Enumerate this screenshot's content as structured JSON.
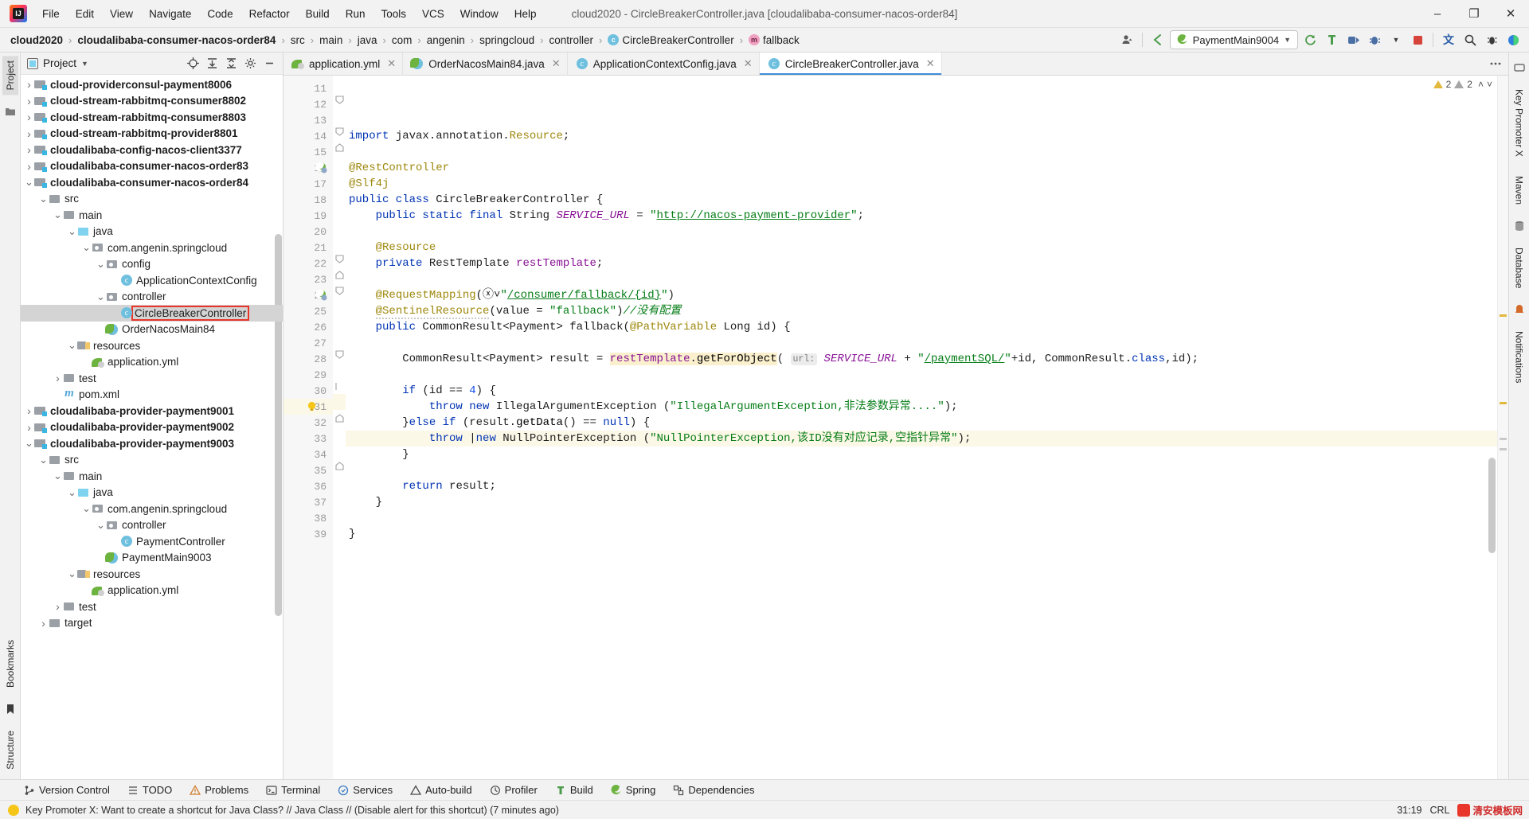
{
  "window": {
    "title": "cloud2020 - CircleBreakerController.java [cloudalibaba-consumer-nacos-order84]",
    "minimize": "–",
    "maximize": "❐",
    "close": "✕"
  },
  "menubar": [
    {
      "label": "File"
    },
    {
      "label": "Edit"
    },
    {
      "label": "View"
    },
    {
      "label": "Navigate"
    },
    {
      "label": "Code"
    },
    {
      "label": "Refactor"
    },
    {
      "label": "Build"
    },
    {
      "label": "Run"
    },
    {
      "label": "Tools"
    },
    {
      "label": "VCS"
    },
    {
      "label": "Window"
    },
    {
      "label": "Help"
    }
  ],
  "breadcrumb": [
    {
      "label": "cloud2020",
      "bold": true
    },
    {
      "label": "cloudalibaba-consumer-nacos-order84",
      "bold": true
    },
    {
      "label": "src",
      "bold": false
    },
    {
      "label": "main",
      "bold": false
    },
    {
      "label": "java",
      "bold": false
    },
    {
      "label": "com",
      "bold": false
    },
    {
      "label": "angenin",
      "bold": false
    },
    {
      "label": "springcloud",
      "bold": false
    },
    {
      "label": "controller",
      "bold": false
    },
    {
      "label": "CircleBreakerController",
      "bold": false,
      "badge": "c"
    },
    {
      "label": "fallback",
      "bold": false,
      "badge": "m"
    }
  ],
  "toolbar": {
    "run_config": "PaymentMain9004",
    "icons": [
      "user-icon",
      "back-arrow-icon",
      "update-project-icon",
      "build-icon",
      "run-icon",
      "debug-icon",
      "stop-icon",
      "translate-icon",
      "search-icon",
      "bug-icon",
      "ide-icon"
    ]
  },
  "project_panel": {
    "title": "Project",
    "tools": [
      "locate-icon",
      "expand-all-icon",
      "collapse-all-icon",
      "settings-icon",
      "hide-icon"
    ],
    "tree": [
      {
        "label": "cloud-providerconsul-payment8006",
        "indent": 1,
        "arrow": "collapsed",
        "icon": "module",
        "bold": true
      },
      {
        "label": "cloud-stream-rabbitmq-consumer8802",
        "indent": 1,
        "arrow": "collapsed",
        "icon": "module",
        "bold": true
      },
      {
        "label": "cloud-stream-rabbitmq-consumer8803",
        "indent": 1,
        "arrow": "collapsed",
        "icon": "module",
        "bold": true
      },
      {
        "label": "cloud-stream-rabbitmq-provider8801",
        "indent": 1,
        "arrow": "collapsed",
        "icon": "module",
        "bold": true
      },
      {
        "label": "cloudalibaba-config-nacos-client3377",
        "indent": 1,
        "arrow": "collapsed",
        "icon": "module",
        "bold": true
      },
      {
        "label": "cloudalibaba-consumer-nacos-order83",
        "indent": 1,
        "arrow": "collapsed",
        "icon": "module",
        "bold": true
      },
      {
        "label": "cloudalibaba-consumer-nacos-order84",
        "indent": 1,
        "arrow": "expanded",
        "icon": "module",
        "bold": true
      },
      {
        "label": "src",
        "indent": 2,
        "arrow": "expanded",
        "icon": "folder",
        "bold": false
      },
      {
        "label": "main",
        "indent": 3,
        "arrow": "expanded",
        "icon": "folder",
        "bold": false
      },
      {
        "label": "java",
        "indent": 4,
        "arrow": "expanded",
        "icon": "srcfolder",
        "bold": false
      },
      {
        "label": "com.angenin.springcloud",
        "indent": 5,
        "arrow": "expanded",
        "icon": "pkg",
        "bold": false
      },
      {
        "label": "config",
        "indent": 6,
        "arrow": "expanded",
        "icon": "pkg",
        "bold": false
      },
      {
        "label": "ApplicationContextConfig",
        "indent": 7,
        "arrow": "none",
        "icon": "javacls",
        "bold": false
      },
      {
        "label": "controller",
        "indent": 6,
        "arrow": "expanded",
        "icon": "pkg",
        "bold": false
      },
      {
        "label": "CircleBreakerController",
        "indent": 7,
        "arrow": "none",
        "icon": "javacls",
        "bold": false,
        "selected": true,
        "highlighted": true
      },
      {
        "label": "OrderNacosMain84",
        "indent": 6,
        "arrow": "none",
        "icon": "springcls",
        "bold": false
      },
      {
        "label": "resources",
        "indent": 4,
        "arrow": "expanded",
        "icon": "resfolder",
        "bold": false
      },
      {
        "label": "application.yml",
        "indent": 5,
        "arrow": "none",
        "icon": "yml",
        "bold": false
      },
      {
        "label": "test",
        "indent": 3,
        "arrow": "collapsed",
        "icon": "folder",
        "bold": false
      },
      {
        "label": "pom.xml",
        "indent": 3,
        "arrow": "none",
        "icon": "maven",
        "bold": false
      },
      {
        "label": "cloudalibaba-provider-payment9001",
        "indent": 1,
        "arrow": "collapsed",
        "icon": "module",
        "bold": true
      },
      {
        "label": "cloudalibaba-provider-payment9002",
        "indent": 1,
        "arrow": "collapsed",
        "icon": "module",
        "bold": true
      },
      {
        "label": "cloudalibaba-provider-payment9003",
        "indent": 1,
        "arrow": "expanded",
        "icon": "module",
        "bold": true
      },
      {
        "label": "src",
        "indent": 2,
        "arrow": "expanded",
        "icon": "folder",
        "bold": false
      },
      {
        "label": "main",
        "indent": 3,
        "arrow": "expanded",
        "icon": "folder",
        "bold": false
      },
      {
        "label": "java",
        "indent": 4,
        "arrow": "expanded",
        "icon": "srcfolder",
        "bold": false
      },
      {
        "label": "com.angenin.springcloud",
        "indent": 5,
        "arrow": "expanded",
        "icon": "pkg",
        "bold": false
      },
      {
        "label": "controller",
        "indent": 6,
        "arrow": "expanded",
        "icon": "pkg",
        "bold": false
      },
      {
        "label": "PaymentController",
        "indent": 7,
        "arrow": "none",
        "icon": "javacls",
        "bold": false
      },
      {
        "label": "PaymentMain9003",
        "indent": 6,
        "arrow": "none",
        "icon": "springcls",
        "bold": false
      },
      {
        "label": "resources",
        "indent": 4,
        "arrow": "expanded",
        "icon": "resfolder",
        "bold": false
      },
      {
        "label": "application.yml",
        "indent": 5,
        "arrow": "none",
        "icon": "yml",
        "bold": false
      },
      {
        "label": "test",
        "indent": 3,
        "arrow": "collapsed",
        "icon": "folder",
        "bold": false
      },
      {
        "label": "target",
        "indent": 2,
        "arrow": "collapsed",
        "icon": "folder",
        "bold": false
      }
    ]
  },
  "left_rail": {
    "tabs": [
      "Project"
    ],
    "bottom_tabs": [
      "Bookmarks",
      "Structure"
    ]
  },
  "right_rail": {
    "tabs": [
      "Key Promoter X",
      "Maven",
      "Database",
      "Notifications"
    ]
  },
  "editor_tabs": [
    {
      "label": "application.yml",
      "icon": "yml",
      "active": false
    },
    {
      "label": "OrderNacosMain84.java",
      "icon": "springcls",
      "active": false
    },
    {
      "label": "ApplicationContextConfig.java",
      "icon": "javacls",
      "active": false
    },
    {
      "label": "CircleBreakerController.java",
      "icon": "javacls",
      "active": true
    }
  ],
  "inspection": {
    "warnings_yellow": "2",
    "warnings_grey": "2",
    "chevron_up": "˄",
    "chevron_down": "˅"
  },
  "code": {
    "first_line": 11,
    "current_line": 31,
    "lines": [
      {
        "n": 11,
        "html": ""
      },
      {
        "n": 12,
        "fold": "start",
        "html": "<span class=\"kw\">import</span> javax.annotation.<span class=\"ann\">Resource</span>;"
      },
      {
        "n": 13,
        "html": ""
      },
      {
        "n": 14,
        "fold": "start",
        "html": "<span class=\"ann\">@RestController</span>"
      },
      {
        "n": 15,
        "fold": "end",
        "html": "<span class=\"ann\">@Slf4j</span>"
      },
      {
        "n": 16,
        "gmark": "spring-bean-icon",
        "html": "<span class=\"kw\">public class</span> CircleBreakerController {"
      },
      {
        "n": 17,
        "html": "    <span class=\"kw\">public static final</span> String <span class=\"static-fld\">SERVICE_URL</span> = <span class=\"str\">\"</span><span class=\"strlink\">http://nacos-payment-provider</span><span class=\"str\">\"</span>;"
      },
      {
        "n": 18,
        "html": ""
      },
      {
        "n": 19,
        "html": "    <span class=\"ann\">@Resource</span>"
      },
      {
        "n": 20,
        "html": "    <span class=\"kw\">private</span> RestTemplate <span class=\"fld\">restTemplate</span>;"
      },
      {
        "n": 21,
        "html": ""
      },
      {
        "n": 22,
        "fold": "start",
        "html": "    <span class=\"ann\">@RequestMapping</span>(<span class=\"gutter-globe\">ⓧ˅</span><span class=\"str\">\"</span><span class=\"strlink\">/consumer/fallback/{id}</span><span class=\"str\">\"</span>)"
      },
      {
        "n": 23,
        "fold": "end",
        "html": "    <span class=\"ann warnsq\">@SentinelResource</span>(value = <span class=\"str\">\"fallback\"</span>)<span class=\"cmt-green\">//没有配置</span>"
      },
      {
        "n": 24,
        "gmark": "spring-bean-icon",
        "fold": "start",
        "html": "    <span class=\"kw\">public</span> CommonResult&lt;Payment&gt; fallback(<span class=\"ann\">@PathVariable</span> Long id) {"
      },
      {
        "n": 25,
        "html": ""
      },
      {
        "n": 26,
        "html": "        CommonResult&lt;Payment&gt; result = <span class=\"hl\"><span class=\"fld\">restTemplate</span>.<span class=\"mth\">getForObject</span></span>( <span class=\"param-hint\">url:</span> <span class=\"static-fld\">SERVICE_URL</span> + <span class=\"str\">\"</span><span class=\"strlink\">/paymentSQL/</span><span class=\"str\">\"</span>+id, CommonResult.<span class=\"kw\">class</span>,id);"
      },
      {
        "n": 27,
        "html": ""
      },
      {
        "n": 28,
        "fold": "start",
        "html": "        <span class=\"kw\">if</span> (id == <span class=\"num\">4</span>) {"
      },
      {
        "n": 29,
        "html": "            <span class=\"kw\">throw new</span> IllegalArgumentException (<span class=\"str\">\"IllegalArgumentException,非法参数异常....\"</span>);"
      },
      {
        "n": 30,
        "fold": "mid",
        "html": "        }<span class=\"kw\">else if</span> (result.<span class=\"mth\">getData</span>() == <span class=\"kw\">null</span>) {"
      },
      {
        "n": 31,
        "current": true,
        "gmark": "bulb-icon",
        "html": "            <span class=\"kw\">throw </span>|<span class=\"kw\">new</span> NullPointerException (<span class=\"str\">\"NullPointerException,该ID没有对应记录,空指针异常\"</span>);"
      },
      {
        "n": 32,
        "fold": "end",
        "html": "        }"
      },
      {
        "n": 33,
        "html": ""
      },
      {
        "n": 34,
        "html": "        <span class=\"kw\">return</span> result;"
      },
      {
        "n": 35,
        "fold": "end",
        "html": "    }"
      },
      {
        "n": 36,
        "html": ""
      },
      {
        "n": 37,
        "html": "}"
      },
      {
        "n": 38,
        "html": ""
      },
      {
        "n": 39,
        "html": ""
      }
    ]
  },
  "bottom_tools": [
    {
      "label": "Version Control",
      "icon": "branch-icon"
    },
    {
      "label": "TODO",
      "icon": "list-icon"
    },
    {
      "label": "Problems",
      "icon": "warning-icon"
    },
    {
      "label": "Terminal",
      "icon": "terminal-icon"
    },
    {
      "label": "Services",
      "icon": "services-icon"
    },
    {
      "label": "Auto-build",
      "icon": "autobuild-icon"
    },
    {
      "label": "Profiler",
      "icon": "profiler-icon"
    },
    {
      "label": "Build",
      "icon": "build-icon"
    },
    {
      "label": "Spring",
      "icon": "spring-icon"
    },
    {
      "label": "Dependencies",
      "icon": "dependencies-icon"
    }
  ],
  "statusbar": {
    "message": "Key Promoter X: Want to create a shortcut for Java Class? // Java Class // (Disable alert for this shortcut) (7 minutes ago)",
    "caret": "31:19",
    "line_sep": "CRL",
    "watermark": "清安模板网"
  }
}
